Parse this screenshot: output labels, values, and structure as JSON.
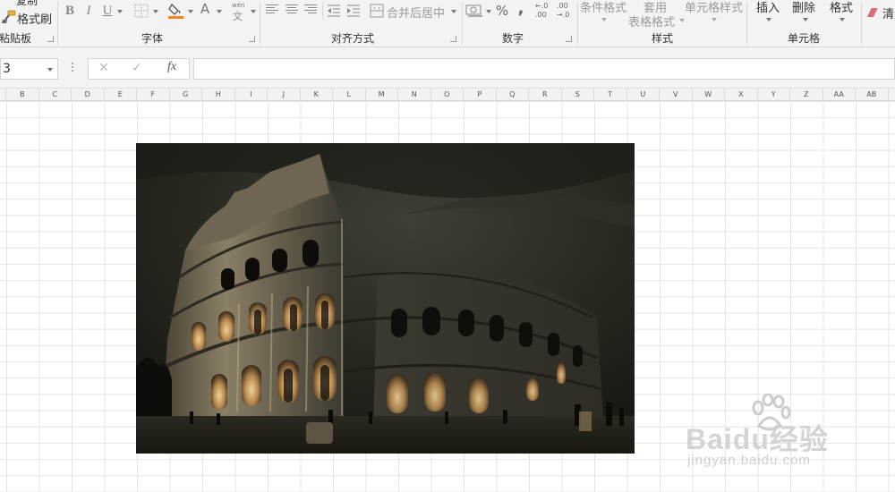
{
  "ribbon": {
    "clipboard": {
      "copy_label": "复制",
      "format_painter_label": "格式刷",
      "group_label": "粘贴板"
    },
    "font": {
      "bold": "B",
      "italic": "I",
      "underline": "U",
      "font_color_letter": "A",
      "fill_color_hex": "#f58220",
      "font_color_hex": "#d9352a",
      "phonetic_top": "wén",
      "phonetic_bottom": "文",
      "group_label": "字体"
    },
    "alignment": {
      "merge_center_label": "合并后居中",
      "group_label": "对齐方式"
    },
    "number": {
      "percent": "%",
      "comma": ",",
      "inc_decimal_top": "←.0",
      "inc_decimal_bottom": ".00",
      "dec_decimal_top": ".00",
      "dec_decimal_bottom": "→.0",
      "group_label": "数字"
    },
    "styles": {
      "conditional_format_label": "条件格式",
      "table_format_line1": "套用",
      "table_format_line2": "表格格式",
      "cell_style_label": "单元格样式",
      "group_label": "样式"
    },
    "cells": {
      "insert_label": "插入",
      "delete_label": "删除",
      "format_label": "格式",
      "group_label": "单元格"
    },
    "editing": {
      "clear_label": "清"
    }
  },
  "formula_bar": {
    "name_box_value": "3",
    "cancel_glyph": "✕",
    "enter_glyph": "✓",
    "fx_label": "fx",
    "formula_value": ""
  },
  "columns": [
    "B",
    "C",
    "D",
    "E",
    "F",
    "G",
    "H",
    "I",
    "J",
    "K",
    "L",
    "M",
    "N",
    "O",
    "P",
    "Q",
    "R",
    "S",
    "T",
    "U",
    "V",
    "W",
    "X",
    "Y",
    "Z",
    "AA",
    "AB"
  ],
  "watermark": {
    "brand": "Baidu经验",
    "url": "jingyan.baidu.com"
  },
  "colors": {
    "ribbon_bg": "#f3f3f3",
    "grid_line": "#e4e4e4",
    "header_bg": "#f2f2f2"
  }
}
